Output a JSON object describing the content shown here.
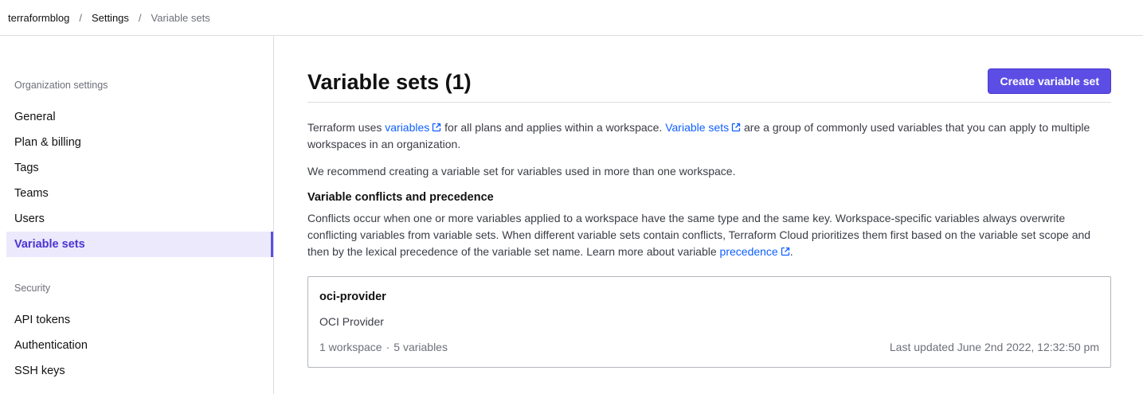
{
  "breadcrumb": {
    "org": "terraformblog",
    "settings": "Settings",
    "current": "Variable sets",
    "separator": "/"
  },
  "sidebar": {
    "section_org": "Organization settings",
    "items": [
      {
        "label": "General"
      },
      {
        "label": "Plan & billing"
      },
      {
        "label": "Tags"
      },
      {
        "label": "Teams"
      },
      {
        "label": "Users"
      },
      {
        "label": "Variable sets",
        "active": true
      }
    ],
    "section_security": "Security",
    "security_items": [
      {
        "label": "API tokens"
      },
      {
        "label": "Authentication"
      },
      {
        "label": "SSH keys"
      }
    ]
  },
  "main": {
    "title": "Variable sets (1)",
    "create_button": "Create variable set",
    "intro": {
      "part1": "Terraform uses ",
      "link1": "variables",
      "part2": " for all plans and applies within a workspace. ",
      "link2": "Variable sets",
      "part3": " are a group of commonly used variables that you can apply to multiple workspaces in an organization."
    },
    "recommend": "We recommend creating a variable set for variables used in more than one workspace.",
    "conflicts_heading": "Variable conflicts and precedence",
    "conflicts": {
      "text": "Conflicts occur when one or more variables applied to a workspace have the same type and the same key. Workspace-specific variables always overwrite conflicting variables from variable sets. When different variable sets contain conflicts, Terraform Cloud prioritizes them first based on the variable set scope and then by the lexical precedence of the variable set name. Learn more about variable ",
      "link": "precedence",
      "end": "."
    },
    "variable_set": {
      "name": "oci-provider",
      "description": "OCI Provider",
      "workspaces": "1 workspace",
      "separator": "·",
      "variables": "5 variables",
      "updated": "Last updated June 2nd 2022, 12:32:50 pm"
    }
  },
  "colors": {
    "accent": "#5c4ee5",
    "link": "#1060ff",
    "active_bg": "#ebe9fb"
  }
}
